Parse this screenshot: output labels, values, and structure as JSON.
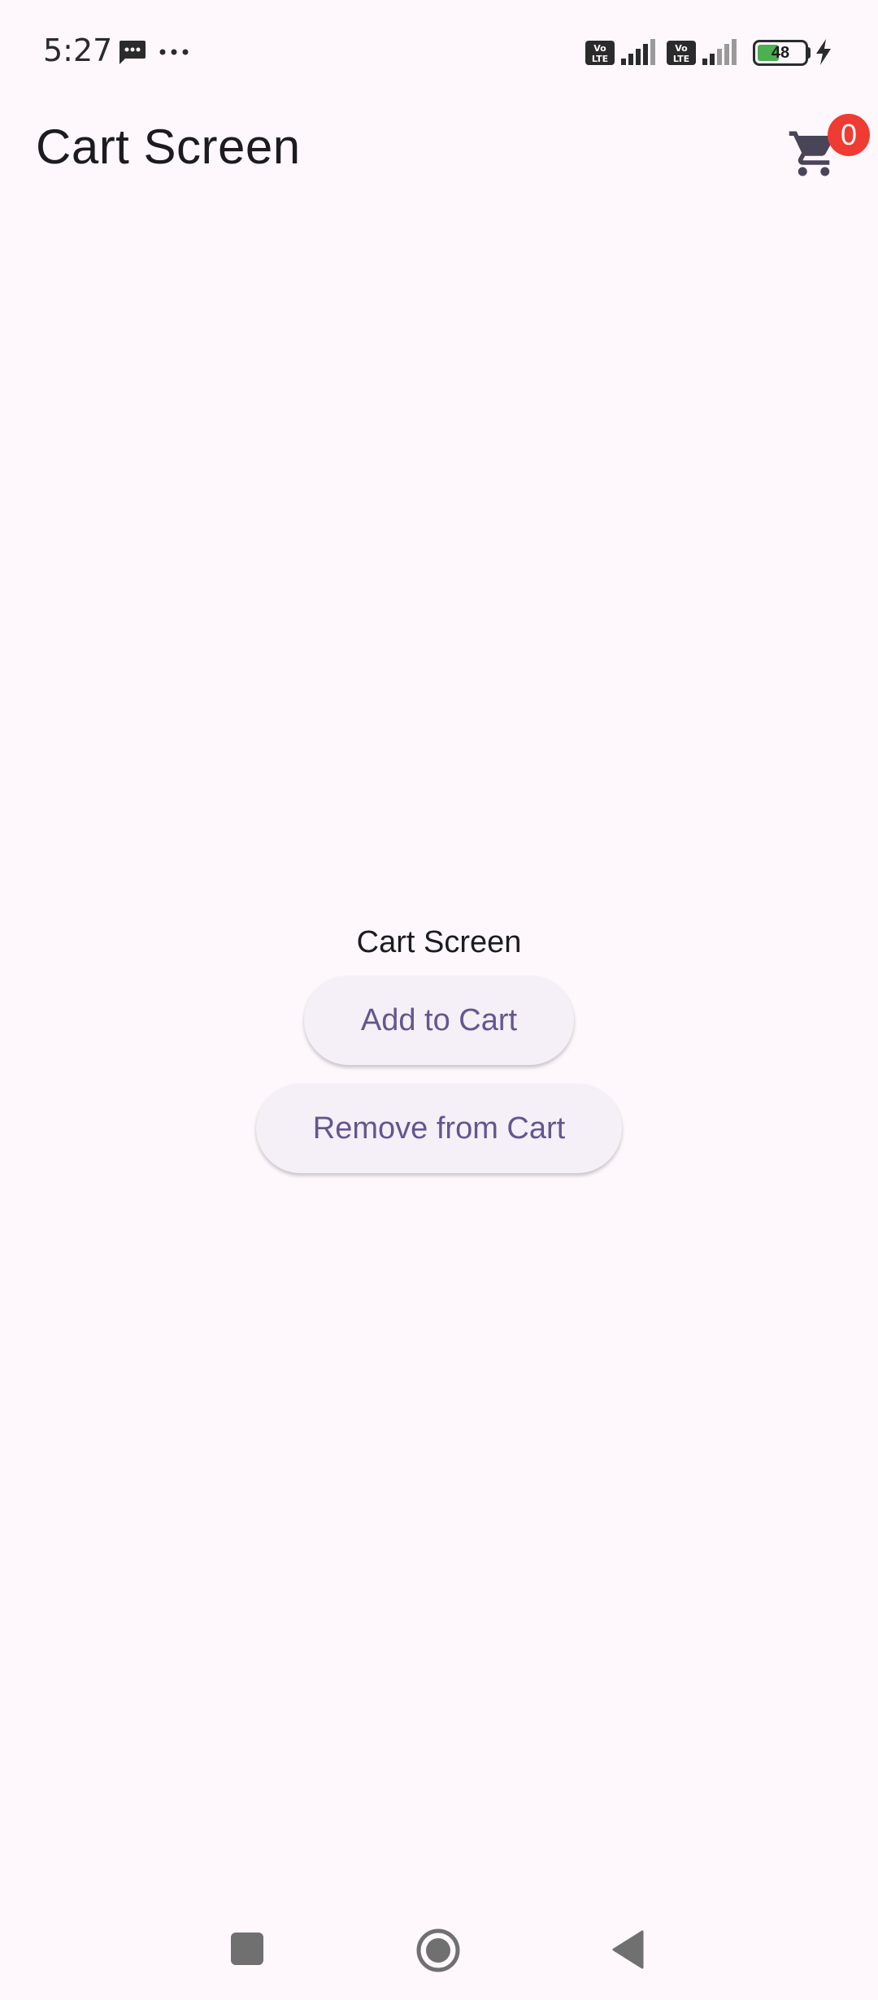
{
  "status_bar": {
    "time": "5:27",
    "battery_level": "48",
    "icons": [
      "message-icon",
      "more-dots-icon",
      "volte-icon",
      "signal-icon",
      "volte-icon",
      "signal-icon",
      "battery-icon",
      "charging-bolt-icon"
    ]
  },
  "app_bar": {
    "title": "Cart Screen",
    "cart_icon": "shopping-cart-icon",
    "cart_count": "0"
  },
  "main": {
    "label": "Cart Screen",
    "add_button_label": "Add to Cart",
    "remove_button_label": "Remove from Cart"
  },
  "nav_bar": {
    "icons": [
      "recents-square-icon",
      "home-circle-icon",
      "back-triangle-icon"
    ]
  },
  "colors": {
    "background": "#fef8fc",
    "button_text": "#65558f",
    "button_bg": "#f5eff7",
    "badge": "#ef3b32",
    "battery_fill": "#4caf50"
  }
}
